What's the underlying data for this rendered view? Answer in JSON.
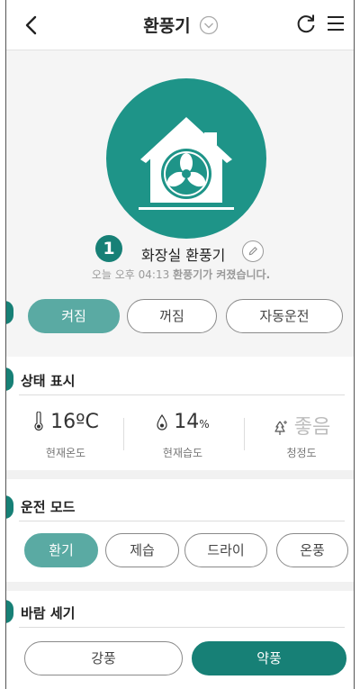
{
  "header": {
    "title": "환풍기",
    "icons": [
      "back-arrow-icon",
      "chevron-down-icon",
      "refresh-icon",
      "menu-icon"
    ]
  },
  "device": {
    "icon": "house-fan-icon",
    "step_badge": "1",
    "name": "화장실 환풍기",
    "status_time": "오늘 오후 04:13",
    "status_msg": "환풍기가 켜졌습니다.",
    "accent_color": "#1e9488"
  },
  "power": {
    "on_label": "켜짐",
    "off_label": "꺼짐",
    "auto_label": "자동운전",
    "selected": "켜짐"
  },
  "status_display": {
    "title": "상태 표시",
    "temperature": {
      "value": "16ºC",
      "label": "현재온도",
      "icon": "thermometer-icon"
    },
    "humidity": {
      "value": "14",
      "unit": "%",
      "label": "현재습도",
      "icon": "droplet-icon"
    },
    "cleanliness": {
      "value": "좋음",
      "label": "청정도",
      "icon": "sparkle-tree-icon"
    }
  },
  "run_mode": {
    "title": "운전 모드",
    "options": [
      "환기",
      "제습",
      "드라이",
      "온풍"
    ],
    "selected": "환기"
  },
  "wind": {
    "title": "바람 세기",
    "options": [
      "강풍",
      "약풍"
    ],
    "selected": "약풍"
  }
}
